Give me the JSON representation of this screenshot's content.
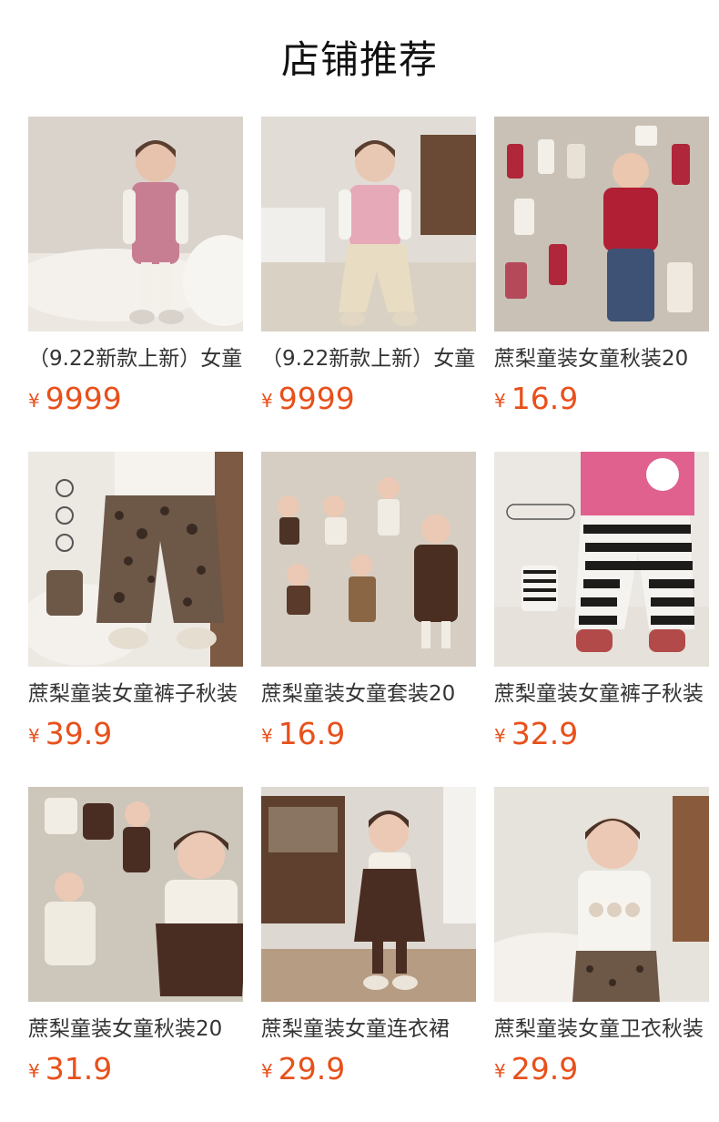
{
  "page": {
    "title": "店铺推荐"
  },
  "theme": {
    "price_color": "#e8501b"
  },
  "products": [
    {
      "name": "（9.22新款上新）女童",
      "currency": "¥",
      "price": "9999",
      "image": "toddler-pink-pinafore-photo"
    },
    {
      "name": "（9.22新款上新）女童",
      "currency": "¥",
      "price": "9999",
      "image": "toddler-knit-vest-photo"
    },
    {
      "name": "蔗梨童装女童秋装20",
      "currency": "¥",
      "price": "16.9",
      "image": "red-cardigan-collage-photo"
    },
    {
      "name": "蔗梨童装女童裤子秋装",
      "currency": "¥",
      "price": "39.9",
      "image": "leopard-pants-photo"
    },
    {
      "name": "蔗梨童装女童套装20",
      "currency": "¥",
      "price": "16.9",
      "image": "brown-dress-collage-photo"
    },
    {
      "name": "蔗梨童装女童裤子秋装",
      "currency": "¥",
      "price": "32.9",
      "image": "striped-pants-photo"
    },
    {
      "name": "蔗梨童装女童秋装20",
      "currency": "¥",
      "price": "31.9",
      "image": "brown-skirt-collage-photo"
    },
    {
      "name": "蔗梨童装女童连衣裙",
      "currency": "¥",
      "price": "29.9",
      "image": "brown-pinafore-photo"
    },
    {
      "name": "蔗梨童装女童卫衣秋装",
      "currency": "¥",
      "price": "29.9",
      "image": "hello-kitty-sweatshirt-photo"
    }
  ]
}
